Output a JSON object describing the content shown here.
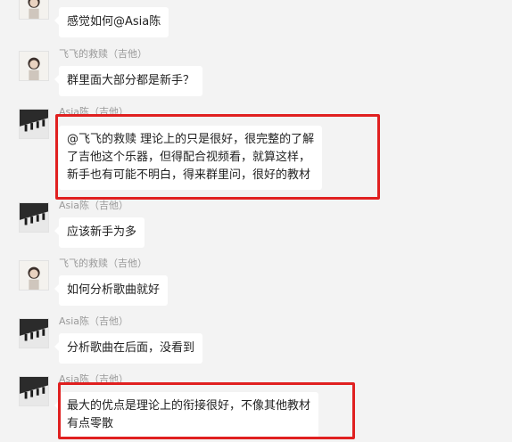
{
  "messages": [
    {
      "sender": "",
      "lines": [
        "感觉如何@Asia陈"
      ]
    },
    {
      "sender": "飞飞的救赎（吉他）",
      "lines": [
        "群里面大部分都是新手？"
      ]
    },
    {
      "sender": "Asia陈（吉他）",
      "lines": [
        "@飞飞的救赎 理论上的只是很好，很完整的了解",
        "了吉他这个乐器，但得配合视频看，就算这样，",
        "新手也有可能不明白，得来群里问，很好的教材"
      ]
    },
    {
      "sender": "Asia陈（吉他）",
      "lines": [
        "应该新手为多"
      ]
    },
    {
      "sender": "飞飞的救赎（吉他）",
      "lines": [
        "如何分析歌曲就好"
      ]
    },
    {
      "sender": "Asia陈（吉他）",
      "lines": [
        "分析歌曲在后面，没看到"
      ]
    },
    {
      "sender": "Asia陈（吉他）",
      "lines": [
        "最大的优点是理论上的衔接很好，不像其他教材",
        "有点零散"
      ]
    }
  ],
  "colors": {
    "background": "#f3f3f3",
    "bubble": "#ffffff",
    "highlight": "#e02020",
    "sender_text": "#9a9a9a"
  }
}
